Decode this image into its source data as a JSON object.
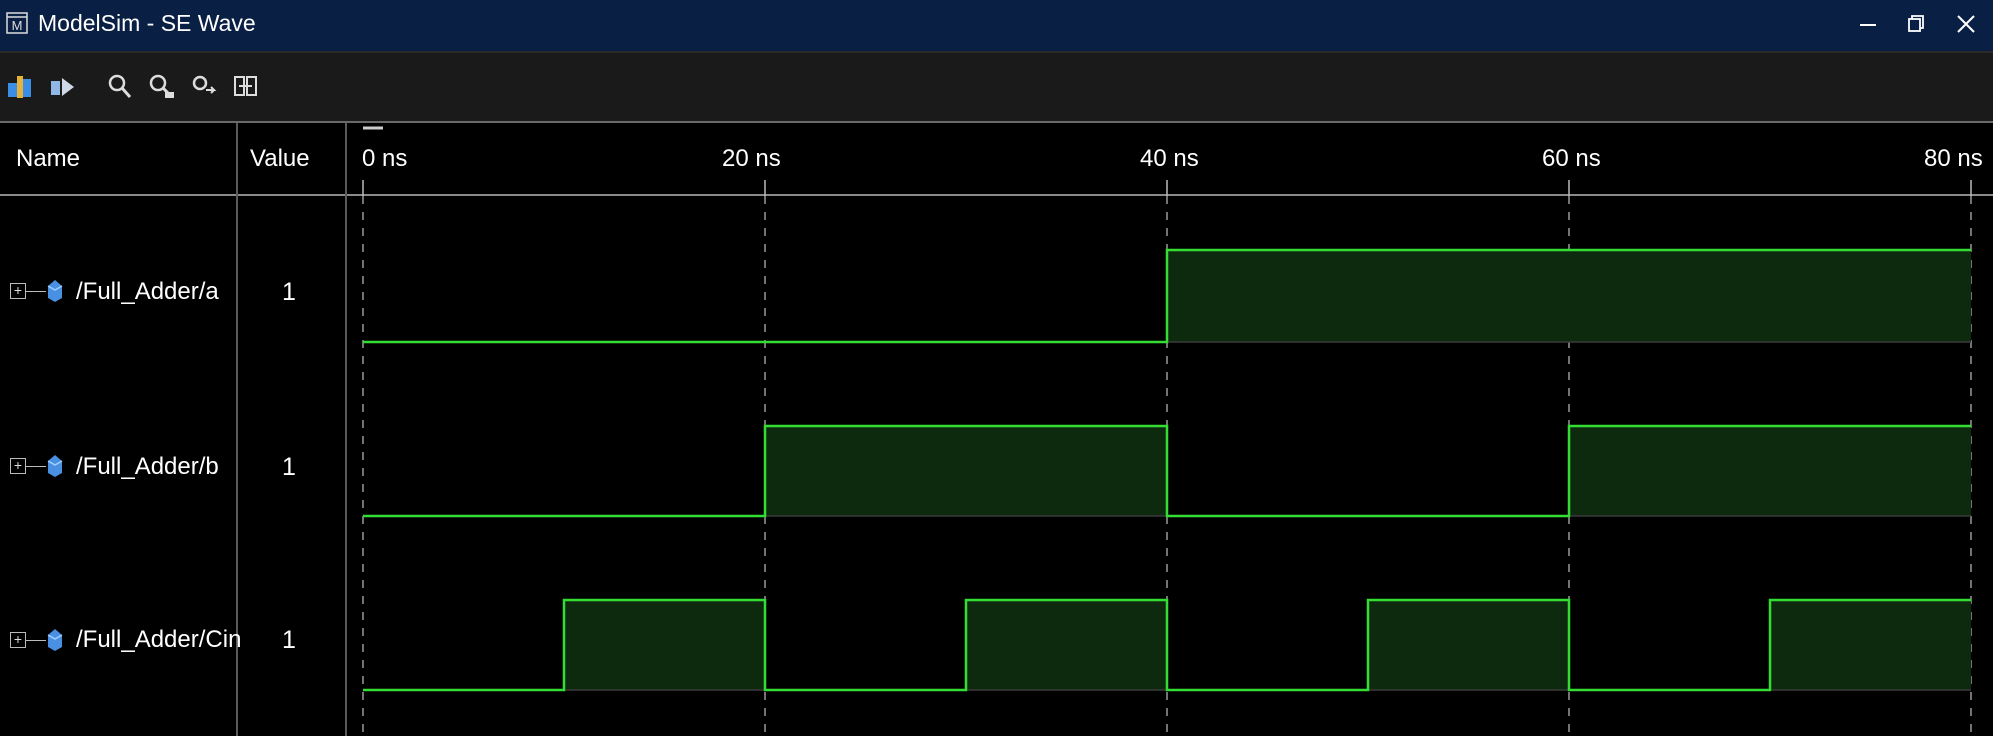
{
  "window": {
    "title": "ModelSim - SE Wave"
  },
  "toolbar": {
    "buttons": [
      {
        "name": "add-signal-icon"
      },
      {
        "name": "remove-signal-icon"
      },
      {
        "name": "zoom-in-icon"
      },
      {
        "name": "zoom-out-icon"
      },
      {
        "name": "zoom-full-icon"
      },
      {
        "name": "zoom-range-icon"
      }
    ]
  },
  "columns": {
    "name": "Name",
    "value": "Value"
  },
  "timeline": {
    "unit": "ns",
    "ticks": [
      "0 ns",
      "20 ns",
      "40 ns",
      "60 ns",
      "80 ns"
    ],
    "range": [
      0,
      80
    ]
  },
  "signals": [
    {
      "name": "/Full_Adder/a",
      "value": "1"
    },
    {
      "name": "/Full_Adder/b",
      "value": "1"
    },
    {
      "name": "/Full_Adder/Cin",
      "value": "1"
    }
  ],
  "chart_data": {
    "type": "line",
    "xlabel": "",
    "ylabel": "",
    "xlim": [
      0,
      80
    ],
    "ylim": [
      0,
      1
    ],
    "x_ticks": [
      "0 ns",
      "20 ns",
      "40 ns",
      "60 ns",
      "80 ns"
    ],
    "series": [
      {
        "name": "/Full_Adder/a",
        "transitions": [
          [
            0,
            0
          ],
          [
            40,
            1
          ]
        ],
        "end": 80
      },
      {
        "name": "/Full_Adder/b",
        "transitions": [
          [
            0,
            0
          ],
          [
            20,
            1
          ],
          [
            40,
            0
          ],
          [
            60,
            1
          ]
        ],
        "end": 80
      },
      {
        "name": "/Full_Adder/Cin",
        "transitions": [
          [
            0,
            0
          ],
          [
            10,
            1
          ],
          [
            20,
            0
          ],
          [
            30,
            1
          ],
          [
            40,
            0
          ],
          [
            50,
            1
          ],
          [
            60,
            0
          ],
          [
            70,
            1
          ]
        ],
        "end": 80
      }
    ],
    "grid": "dashed vertical at 20 ns intervals"
  },
  "colors": {
    "wave": "#33dd33",
    "wave_fill": "#0e2a0e",
    "background": "#000000",
    "titlebar": "#0a1f44"
  }
}
